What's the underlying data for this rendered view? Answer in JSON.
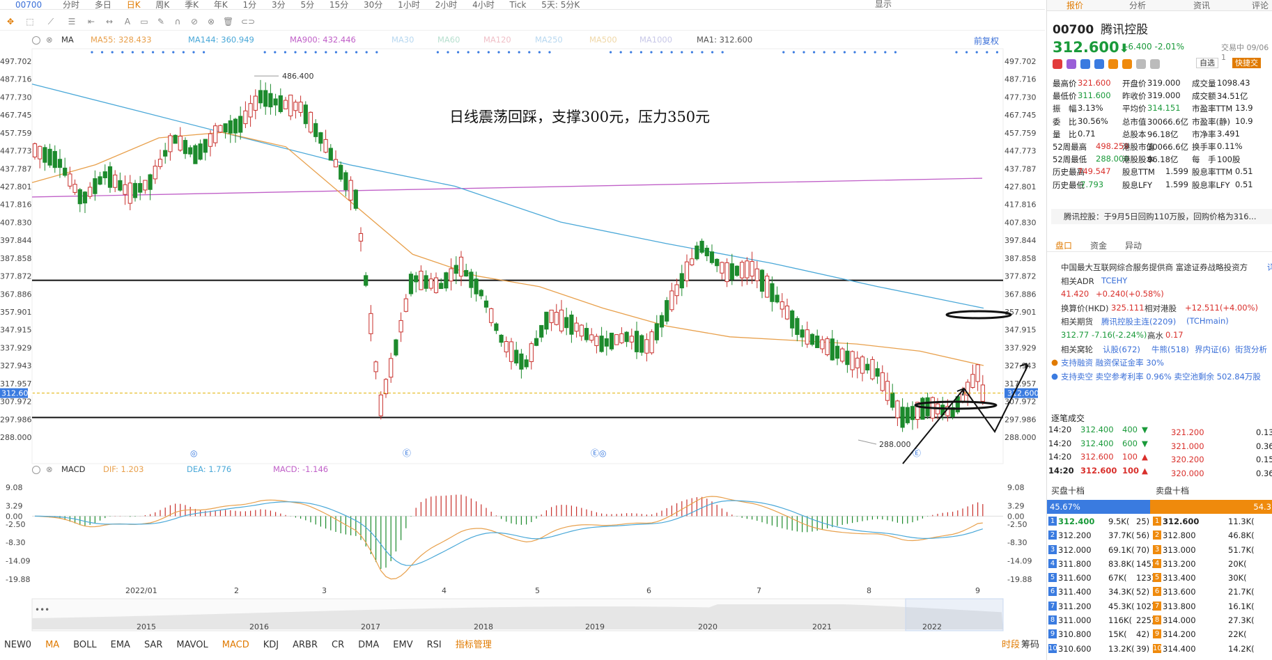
{
  "topbar": {
    "code": "00700",
    "timeframes": [
      "分时",
      "多日",
      "日K",
      "周K",
      "季K",
      "年K",
      "1分",
      "3分",
      "5分",
      "15分",
      "30分",
      "1小时",
      "2小时",
      "4小时",
      "Tick",
      "5天: 5分K"
    ],
    "active": "日K",
    "display": "显示"
  },
  "chart": {
    "ma_label": "MA",
    "ma_items": [
      {
        "text": "MA55: 328.433",
        "color": "#e8a04c"
      },
      {
        "text": "MA144: 360.949",
        "color": "#4aa8d8"
      },
      {
        "text": "MA900: 432.446",
        "color": "#c060c8"
      },
      {
        "text": "MA30",
        "color": "#b8d8f0"
      },
      {
        "text": "MA60",
        "color": "#b8e0d0"
      },
      {
        "text": "MA120",
        "color": "#f0c0c8"
      },
      {
        "text": "MA250",
        "color": "#b8d8f0"
      },
      {
        "text": "MA500",
        "color": "#f0d8a8"
      },
      {
        "text": "MA1000",
        "color": "#c8c8e8"
      },
      {
        "text": "MA1: 312.600",
        "color": "#555555"
      }
    ],
    "restore_label": "前复权",
    "annotation": "日线震荡回踩，支撑300元，压力350元",
    "high_label": "486.400",
    "low_label": "288.000",
    "current_price_tag": "312.600",
    "y_ticks": [
      "497.702",
      "487.716",
      "477.730",
      "467.745",
      "457.759",
      "447.773",
      "437.787",
      "427.801",
      "417.816",
      "407.830",
      "397.844",
      "387.858",
      "377.872",
      "367.886",
      "357.901",
      "347.915",
      "337.929",
      "327.943",
      "317.957",
      "307.972",
      "297.986",
      "288.000"
    ],
    "x_months": [
      "2022/01",
      "2",
      "3",
      "4",
      "5",
      "6",
      "7",
      "8",
      "9"
    ],
    "nav_years": [
      "2015",
      "2016",
      "2017",
      "2018",
      "2019",
      "2020",
      "2021",
      "2022"
    ],
    "event_markers": [
      "◎",
      "Ⓔ",
      "Ⓔ◎",
      "Ⓔ"
    ],
    "colors": {
      "up": "#c8302c",
      "down": "#1c8a2c",
      "ma55": "#e8a04c",
      "ma144": "#4aa8d8",
      "ma900": "#c060c8"
    }
  },
  "macd": {
    "label": "MACD",
    "dif": "DIF: 1.203",
    "dea": "DEA: 1.776",
    "macd": "MACD: -1.146",
    "y_ticks": [
      "9.08",
      "3.29",
      "0.00",
      "-2.50",
      "-8.30",
      "-14.09",
      "-19.88"
    ]
  },
  "indicators": {
    "items": [
      "NEW0",
      "MA",
      "BOLL",
      "EMA",
      "SAR",
      "MAVOL",
      "MACD",
      "KDJ",
      "ARBR",
      "CR",
      "DMA",
      "EMV",
      "RSI",
      "指标管理"
    ],
    "active": [
      "MA",
      "MACD",
      "指标管理"
    ],
    "right": [
      "时段",
      "筹码"
    ]
  },
  "panel": {
    "tabs": [
      "报价",
      "分析",
      "资讯",
      "评论"
    ],
    "code": "00700",
    "name": "腾讯控股",
    "price": "312.600",
    "arrow": "⬇",
    "change": "-6.400",
    "change_pct": "-2.01%",
    "status": "交易中 09/06 1",
    "fav": "自选",
    "fast": "快捷交",
    "quote_rows": [
      [
        [
          "最高价 ",
          "k"
        ],
        [
          "321.600",
          "r"
        ],
        [
          "开盘价 ",
          "k"
        ],
        [
          "319.000",
          "k"
        ],
        [
          "成交量 ",
          "k"
        ],
        [
          "1098.43",
          "k"
        ]
      ],
      [
        [
          "最低价 ",
          "k"
        ],
        [
          "311.600",
          "g"
        ],
        [
          "昨收价 ",
          "k"
        ],
        [
          "319.000",
          "k"
        ],
        [
          "成交额 ",
          "k"
        ],
        [
          "34.51亿",
          "k"
        ]
      ],
      [
        [
          "振　幅 ",
          "k"
        ],
        [
          "3.13%",
          "k"
        ],
        [
          "平均价 ",
          "k"
        ],
        [
          "314.151",
          "g"
        ],
        [
          "市盈率TTM",
          "k"
        ],
        [
          "13.9",
          "k"
        ]
      ],
      [
        [
          "委　比 ",
          "k"
        ],
        [
          "30.56%",
          "k"
        ],
        [
          "总市值 ",
          "k"
        ],
        [
          "30066.6亿",
          "k"
        ],
        [
          "市盈率(静)",
          "k"
        ],
        [
          "10.9",
          "k"
        ]
      ],
      [
        [
          "量　比 ",
          "k"
        ],
        [
          "0.71",
          "k"
        ],
        [
          "总股本 ",
          "k"
        ],
        [
          "96.18亿",
          "k"
        ],
        [
          "市净率 ",
          "k"
        ],
        [
          "3.491",
          "k"
        ]
      ],
      [
        [
          "52周最高 ",
          "k"
        ],
        [
          "498.259",
          "r"
        ],
        [
          "港股市值 ",
          "k"
        ],
        [
          "30066.6亿",
          "k"
        ],
        [
          "换手率 ",
          "k"
        ],
        [
          "0.11%",
          "k"
        ]
      ],
      [
        [
          "52周最低 ",
          "k"
        ],
        [
          "288.000",
          "g"
        ],
        [
          "港股股本 ",
          "k"
        ],
        [
          "96.18亿",
          "k"
        ],
        [
          "每　手 ",
          "k"
        ],
        [
          "100股",
          "k"
        ]
      ],
      [
        [
          "历史最高 ",
          "k"
        ],
        [
          "749.547",
          "r"
        ],
        [
          "股息TTM ",
          "k"
        ],
        [
          "1.599",
          "k"
        ],
        [
          "股息率TTM ",
          "k"
        ],
        [
          "0.51",
          "k"
        ]
      ],
      [
        [
          "历史最低 ",
          "k"
        ],
        [
          "-7.793",
          "g"
        ],
        [
          "股息LFY ",
          "k"
        ],
        [
          "1.599",
          "k"
        ],
        [
          "股息率LFY ",
          "k"
        ],
        [
          "0.51",
          "k"
        ]
      ]
    ],
    "news": "腾讯控股：于9月5日回购110万股，回购价格为316...",
    "subtabs": [
      "盘口",
      "资金",
      "异动"
    ],
    "info": {
      "desc": "中国最大互联网综合服务提供商 富途证券战略投资方",
      "desc_link": "详",
      "adr_label": "相关ADR",
      "adr_name": "TCEHY",
      "adr_price": "41.420",
      "adr_chg": "+0.240(+0.58%)",
      "conv_label": "换算价(HKD)",
      "conv_price": "325.111",
      "rel_label": "相对港股",
      "rel_val": "+12.511(+4.00%)",
      "fut_label": "相关期货",
      "fut_name": "腾讯控股主连(2209)",
      "fut_code": "(TCHmain)",
      "fut_price": "312.77",
      "fut_chg": "-7.16(-2.24%)",
      "fut_prem_label": "高水",
      "fut_prem": "0.17",
      "war_label": "相关窝轮",
      "war_items": [
        "认股(672)",
        "牛熊(518)",
        "界内证(6)",
        "街货分析"
      ],
      "margin": "支持融资  融资保证金率 30%",
      "short": "支持卖空  卖空参考利率 0.96%  卖空池剩余 502.84万股"
    },
    "ticks_title": "逐笔成交",
    "ticks": [
      [
        "14:20",
        "312.400",
        "400",
        "▼"
      ],
      [
        "14:20",
        "312.400",
        "600",
        "▼"
      ],
      [
        "14:20",
        "312.600",
        "100",
        "▲"
      ],
      [
        "14:20",
        "312.600",
        "100",
        "▲"
      ]
    ],
    "asks": [
      [
        "321.200",
        "0.13"
      ],
      [
        "321.000",
        "0.36"
      ],
      [
        "320.200",
        "0.15"
      ],
      [
        "320.000",
        "0.36"
      ]
    ],
    "buy_title": "买盘十档",
    "sell_title": "卖盘十档",
    "buy_pct": "45.67%",
    "sell_pct": "54.3",
    "buy_ratio": 45.67,
    "orderbook": [
      [
        "1",
        "312.400",
        "9.5K(",
        "25)",
        "1",
        "312.600",
        "11.3K("
      ],
      [
        "2",
        "312.200",
        "37.7K(",
        "56)",
        "2",
        "312.800",
        "46.8K("
      ],
      [
        "3",
        "312.000",
        "69.1K(",
        "70)",
        "3",
        "313.000",
        "51.7K("
      ],
      [
        "4",
        "311.800",
        "83.8K(",
        "145)",
        "4",
        "313.200",
        "20K("
      ],
      [
        "5",
        "311.600",
        "67K(",
        "123)",
        "5",
        "313.400",
        "30K("
      ],
      [
        "6",
        "311.400",
        "34.3K(",
        "52)",
        "6",
        "313.600",
        "21.7K("
      ],
      [
        "7",
        "311.200",
        "45.3K(",
        "102)",
        "7",
        "313.800",
        "16.1K("
      ],
      [
        "8",
        "311.000",
        "116K(",
        "225)",
        "8",
        "314.000",
        "27.3K("
      ],
      [
        "9",
        "310.800",
        "15K(",
        "42)",
        "9",
        "314.200",
        "22K("
      ],
      [
        "10",
        "310.600",
        "13.2K(",
        "39)",
        "10",
        "314.400",
        "14.2K("
      ]
    ]
  },
  "chart_data": {
    "type": "candlestick",
    "title": "",
    "ylim": [
      288,
      497.702
    ],
    "y_high": 486.4,
    "y_low": 288.0,
    "support_lines": [
      375.5,
      299.0
    ],
    "months": [
      "2022/01",
      "2",
      "3",
      "4",
      "5",
      "6",
      "7",
      "8",
      "9"
    ],
    "close_points": [
      [
        "2021-12-01",
        448
      ],
      [
        "2021-12-08",
        442
      ],
      [
        "2021-12-15",
        420
      ],
      [
        "2021-12-22",
        435
      ],
      [
        "2021-12-29",
        424
      ],
      [
        "2022-01-05",
        430
      ],
      [
        "2022-01-12",
        455
      ],
      [
        "2022-01-19",
        445
      ],
      [
        "2022-01-26",
        460
      ],
      [
        "2022-02-02",
        462
      ],
      [
        "2022-02-09",
        478
      ],
      [
        "2022-02-16",
        474
      ],
      [
        "2022-02-23",
        472
      ],
      [
        "2022-03-02",
        448
      ],
      [
        "2022-03-09",
        420
      ],
      [
        "2022-03-15",
        305
      ],
      [
        "2022-03-18",
        330
      ],
      [
        "2022-03-23",
        377
      ],
      [
        "2022-03-30",
        372
      ],
      [
        "2022-04-06",
        384
      ],
      [
        "2022-04-13",
        368
      ],
      [
        "2022-04-20",
        340
      ],
      [
        "2022-04-27",
        328
      ],
      [
        "2022-05-04",
        356
      ],
      [
        "2022-05-11",
        350
      ],
      [
        "2022-05-18",
        340
      ],
      [
        "2022-05-25",
        344
      ],
      [
        "2022-06-01",
        338
      ],
      [
        "2022-06-08",
        368
      ],
      [
        "2022-06-15",
        395
      ],
      [
        "2022-06-22",
        380
      ],
      [
        "2022-06-29",
        382
      ],
      [
        "2022-07-06",
        365
      ],
      [
        "2022-07-13",
        345
      ],
      [
        "2022-07-20",
        338
      ],
      [
        "2022-07-27",
        330
      ],
      [
        "2022-08-03",
        325
      ],
      [
        "2022-08-10",
        299
      ],
      [
        "2022-08-17",
        305
      ],
      [
        "2022-08-24",
        302
      ],
      [
        "2022-08-31",
        324
      ],
      [
        "2022-09-06",
        312.6
      ]
    ],
    "ma55": [
      430,
      440,
      455,
      458,
      450,
      420,
      390,
      378,
      372,
      360,
      350,
      344,
      342,
      340,
      336,
      328
    ],
    "ma144": [
      485,
      470,
      455,
      440,
      428,
      408,
      396,
      385,
      372,
      360
    ],
    "ma900_range": [
      422,
      432.446
    ],
    "macd_dif_end": 1.203,
    "macd_dea_end": 1.776,
    "macd_hist_end": -1.146
  }
}
